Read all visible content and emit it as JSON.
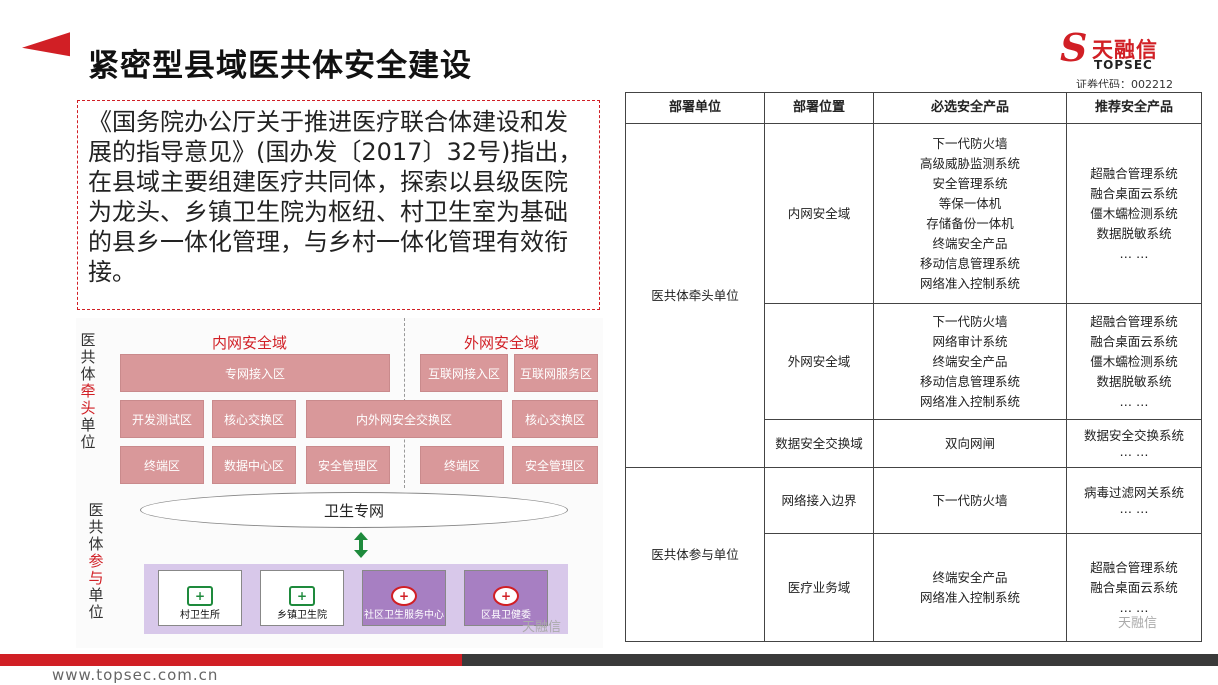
{
  "title": "紧密型县域医共体安全建设",
  "logo": {
    "cn": "天融信",
    "en": "TOPSEC",
    "code": "证券代码：002212"
  },
  "quote": "《国务院办公厅关于推进医疗联合体建设和发展的指导意见》(国办发〔2017〕32号)指出，在县域主要组建医疗共同体，探索以县级医院为龙头、乡镇卫生院为枢纽、村卫生室为基础的县乡一体化管理，与乡村一体化管理有效衔接。",
  "diagram": {
    "lead_label_top": "医共体",
    "lead_label_red": "牵头",
    "lead_label_bottom": "单位",
    "member_label_top": "医共体",
    "member_label_red": "参与",
    "member_label_bottom": "单位",
    "inner_zone": "内网安全域",
    "outer_zone": "外网安全域",
    "blocks": {
      "b1": "专网接入区",
      "b2": "互联网接入区",
      "b3": "互联网服务区",
      "b4": "开发测试区",
      "b5": "核心交换区",
      "b6": "内外网安全交换区",
      "b7": "核心交换区",
      "b8": "终端区",
      "b9": "数据中心区",
      "b10": "安全管理区",
      "b11": "终端区",
      "b12": "安全管理区"
    },
    "network": "卫生专网",
    "units": [
      "村卫生所",
      "乡镇卫生院",
      "社区卫生服务中心",
      "区县卫健委"
    ],
    "watermark": "天融信"
  },
  "table": {
    "headers": [
      "部署单位",
      "部署位置",
      "必选安全产品",
      "推荐安全产品"
    ],
    "lead_unit": "医共体牵头单位",
    "member_unit": "医共体参与单位",
    "rows": [
      {
        "position": "内网安全域",
        "required": "下一代防火墙\n高级威胁监测系统\n安全管理系统\n等保一体机\n存储备份一体机\n终端安全产品\n移动信息管理系统\n网络准入控制系统",
        "recommended": "超融合管理系统\n融合桌面云系统\n僵木蠕检测系统\n数据脱敏系统\n… …"
      },
      {
        "position": "外网安全域",
        "required": "下一代防火墙\n网络审计系统\n终端安全产品\n移动信息管理系统\n网络准入控制系统",
        "recommended": "超融合管理系统\n融合桌面云系统\n僵木蠕检测系统\n数据脱敏系统\n… …"
      },
      {
        "position": "数据安全交换域",
        "required": "双向网闸",
        "recommended": "数据安全交换系统\n… …"
      },
      {
        "position": "网络接入边界",
        "required": "下一代防火墙",
        "recommended": "病毒过滤网关系统\n… …"
      },
      {
        "position": "医疗业务域",
        "required": "终端安全产品\n网络准入控制系统",
        "recommended": "超融合管理系统\n融合桌面云系统\n… …"
      }
    ],
    "watermark": "天融信"
  },
  "footer": {
    "url": "www.topsec.com.cn"
  },
  "colors": {
    "accent": "#d11f25",
    "block": "#d9989a",
    "unit_bar": "#d8c8ea"
  }
}
